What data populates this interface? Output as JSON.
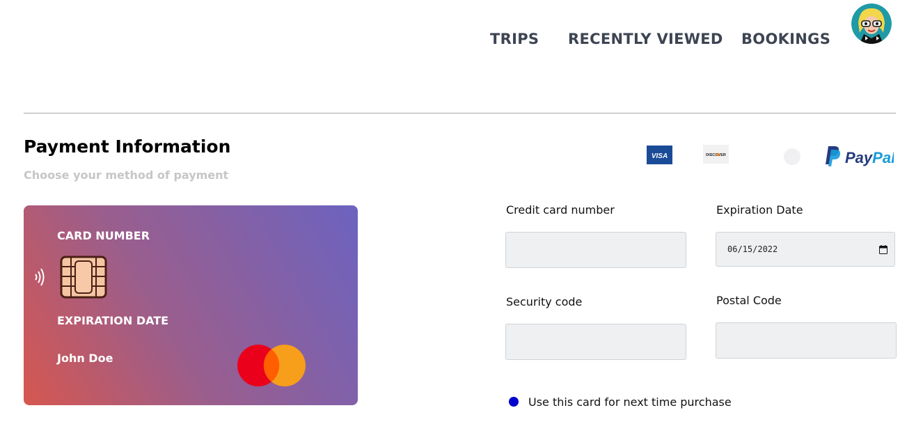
{
  "nav": {
    "items": [
      "TRIPS",
      "RECENTLY VIEWED",
      "BOOKINGS"
    ]
  },
  "page": {
    "title": "Payment Information",
    "subtitle": "Choose your method of payment"
  },
  "payment_methods": {
    "visa": "VISA",
    "discover": "DISCOVER",
    "paypal": "PayPal"
  },
  "card": {
    "number_label": "CARD NUMBER",
    "expiration_label": "EXPIRATION DATE",
    "holder_name": "John Doe"
  },
  "form": {
    "card_number_label": "Credit card number",
    "card_number_value": "",
    "expiration_label": "Expiration Date",
    "expiration_value": "06/15/2022",
    "security_label": "Security code",
    "security_value": "",
    "postal_label": "Postal Code",
    "postal_value": "",
    "save_card_label": "Use this card for next time purchase",
    "save_card_checked": true
  },
  "colors": {
    "nav_text": "#3d4452",
    "card_gradient_start": "#d6574f",
    "card_gradient_end": "#6c63c0",
    "radio": "#0000cd",
    "visa_blue": "#1a4b97",
    "paypal_dark": "#253b80",
    "paypal_light": "#179bd7"
  },
  "icons": [
    "avatar",
    "visa-icon",
    "discover-icon",
    "placeholder-circle-icon",
    "paypal-icon",
    "contactless-icon",
    "chip-icon",
    "mastercard-icon",
    "calendar-icon"
  ]
}
